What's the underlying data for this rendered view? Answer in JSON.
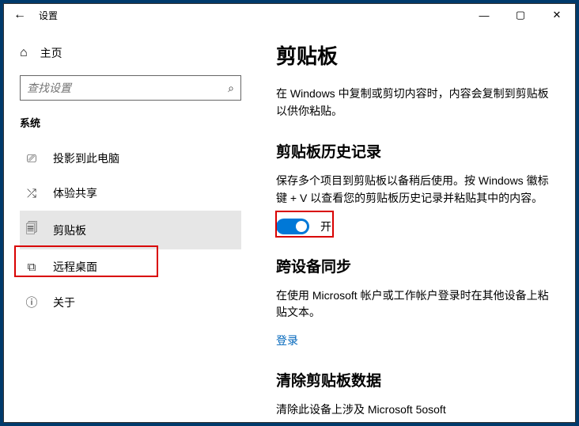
{
  "window": {
    "title": "设置"
  },
  "sidebar": {
    "home": "主页",
    "search_placeholder": "查找设置",
    "category": "系统",
    "items": [
      {
        "icon": "⎙",
        "label": "投影到此电脑"
      },
      {
        "icon": "✚",
        "label": "体验共享"
      },
      {
        "icon": "📋",
        "label": "剪贴板",
        "selected": true
      },
      {
        "icon": "✕",
        "label": "远程桌面"
      },
      {
        "icon": "ⓘ",
        "label": "关于"
      }
    ]
  },
  "content": {
    "title": "剪贴板",
    "intro": "在 Windows 中复制或剪切内容时，内容会复制到剪贴板以供你粘贴。",
    "section1": {
      "heading": "剪贴板历史记录",
      "desc": "保存多个项目到剪贴板以备稍后使用。按 Windows 徽标键 + V 以查看您的剪贴板历史记录并粘贴其中的内容。",
      "toggle_label": "开"
    },
    "section2": {
      "heading": "跨设备同步",
      "desc": "在使用 Microsoft 帐户或工作帐户登录时在其他设备上粘贴文本。",
      "link": "登录"
    },
    "section3": {
      "heading": "清除剪贴板数据",
      "desc": "清除此设备上涉及 Microsoft 5osoft"
    }
  }
}
